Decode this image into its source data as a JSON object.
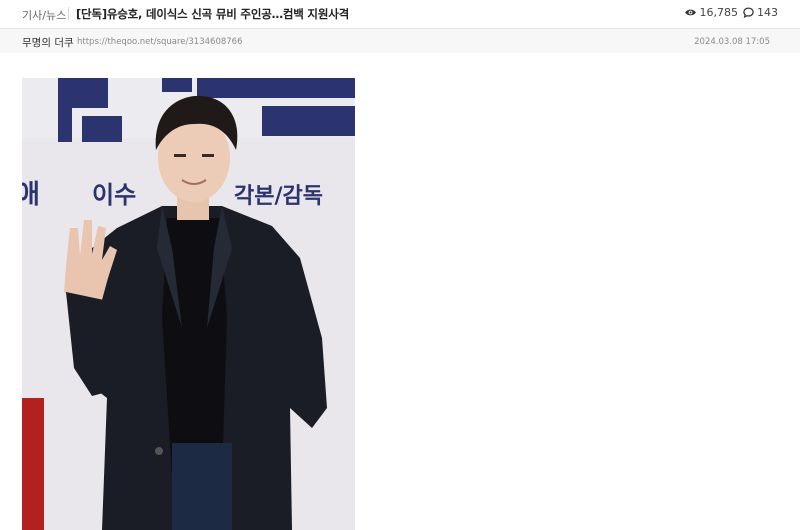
{
  "post": {
    "category": "기사/뉴스",
    "title": "[단독]유승호, 데이식스 신곡 뮤비 주인공…컴백 지원사격",
    "views": "16,785",
    "comments": "143",
    "author": "무명의 더쿠",
    "url": "https://theqoo.net/square/3134608766",
    "date": "2024.03.08 17:05"
  },
  "photo": {
    "backdrop_text_1": "이수",
    "backdrop_text_2": "각본/감독",
    "backdrop_text_3": "애"
  },
  "colors": {
    "backdrop_navy": "#2c3470",
    "backdrop_red": "#b32020",
    "coat": "#1b1d26"
  }
}
